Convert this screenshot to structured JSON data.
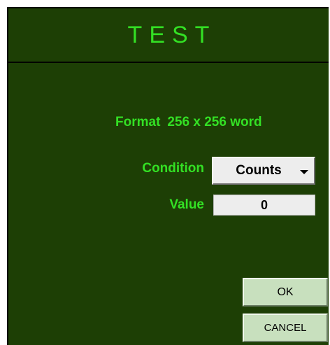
{
  "dialog": {
    "title": "TEST",
    "format": {
      "label": "Format",
      "value": "256 x 256 word"
    },
    "condition": {
      "label": "Condition",
      "selected": "Counts"
    },
    "value": {
      "label": "Value",
      "current": "0"
    },
    "buttons": {
      "ok_label": "OK",
      "cancel_label": "CANCEL"
    }
  },
  "colors": {
    "background": "#1d3f05",
    "text_accent": "#33e024",
    "button_face": "#c8e0be",
    "field_face": "#ededed"
  }
}
